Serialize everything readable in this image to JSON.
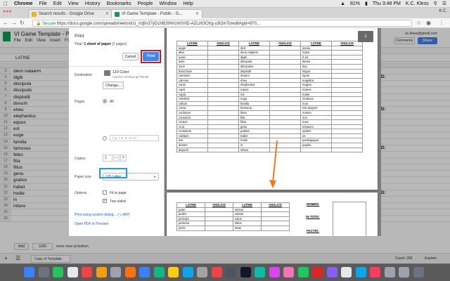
{
  "menubar": {
    "app": "Chrome",
    "items": [
      "File",
      "Edit",
      "View",
      "History",
      "Bookmarks",
      "People",
      "Window",
      "Help"
    ],
    "battery": "81%",
    "clock": "Thu 3:48 PM",
    "user": "K.C. Kless"
  },
  "tabs": [
    {
      "label": "Search results - Google Drive",
      "favicon_color": "#f4b400"
    },
    {
      "label": "VI Game Template - Public - G...",
      "favicon_color": "#0f9d58"
    }
  ],
  "profile_name": "K.C.",
  "omnibox": {
    "secure_label": "Secure",
    "url": "https://docs.google.com/spreadsheets/d/1i_Vq5v37yD1hB2tNVcIn0VtD-AZcz63CKg-u3t2mTo/edit#gid=970..."
  },
  "sheets": {
    "title": "VI Game Template - Pu",
    "menu": [
      "File",
      "Edit",
      "View",
      "Insert",
      "Fo"
    ],
    "user_email": "kc.kless@gmail.com",
    "comments_label": "Comments",
    "share_label": "Share",
    "formula_value": "LATINE",
    "row_numbers": [
      "3",
      "4",
      "5",
      "6",
      "7",
      "8",
      "9",
      "10",
      "11",
      "12",
      "13",
      "14",
      "15",
      "16",
      "17",
      "18",
      "19",
      "20",
      "21",
      "22",
      "23",
      "24",
      "25",
      "26"
    ],
    "col_a": [
      "diem nataiem",
      "digiti",
      "discipula",
      "discipulis",
      "displodit",
      "donum",
      "eheu",
      "elephantus",
      "equus",
      "est",
      "euge",
      "familia",
      "famosus",
      "feles",
      "filia",
      "filius",
      "genu",
      "gratios",
      "habet",
      "hodie",
      "in",
      "infans",
      "",
      ""
    ],
    "right_cells": [
      "",
      "D:",
      "",
      "",
      "",
      "",
      "D:",
      "",
      "",
      "",
      "",
      "",
      "D:",
      "",
      "",
      "",
      "",
      "",
      "",
      "D:",
      "",
      "",
      "",
      ""
    ],
    "bottom_cells": [
      "papilio",
      "sextum"
    ],
    "add_label": "Add",
    "add_count": "1000",
    "add_suffix": "more rows at bottom.",
    "sheet_tab": "Copy of Template",
    "count_label": "Count: 266",
    "explore_label": "Explore"
  },
  "print": {
    "title": "Print",
    "total_prefix": "Total:",
    "total_bold": "1 sheet of paper",
    "total_suffix": "(2 pages)",
    "cancel_label": "Cancel",
    "print_label": "Print",
    "destination_label": "Destination",
    "destination_name": "110 Color",
    "destination_sub": "Generic PostScript Printer",
    "change_label": "Change...",
    "pages_label": "Pages",
    "pages_all": "All",
    "pages_placeholder": "e.g. 1-5, 8, 11-13",
    "copies_label": "Copies",
    "copies_value": "1",
    "paper_label": "Paper size",
    "paper_value": "US Letter",
    "options_label": "Options",
    "fit_label": "Fit to page",
    "twosided_label": "Two-sided",
    "system_dialog_link": "Print using system dialog... (⌥⌘P)",
    "open_pdf_link": "Open PDF in Preview"
  },
  "preview": {
    "page_number": "1",
    "page1_headers": [
      "LATINE",
      "ANGLICE",
      "LATINE",
      "ANGLICE",
      "LATINE",
      "ANGLICE"
    ],
    "page1_col1": [
      "aeger",
      "albe",
      "aurec",
      "aviis",
      "avus",
      "bracchium",
      "caerulee",
      "calceus",
      "canis",
      "capit",
      "caput",
      "celebrat",
      "collum",
      "coma",
      "confusus",
      "consumit",
      "corpus",
      "crus",
      "crustulum",
      "cubitum",
      "dat",
      "dentes",
      "deponit"
    ],
    "page1_col3": [
      "dicit",
      "diem natalem",
      "digiti",
      "discipula",
      "discipulus",
      "displodit",
      "donum",
      "eheu",
      "elephantus",
      "equus",
      "est",
      "euge",
      "familia",
      "famosus",
      "feles",
      "filia",
      "filius",
      "genu",
      "gratias",
      "habet",
      "hodie",
      "in",
      "infans"
    ],
    "page1_col5": [
      "insula",
      "iratus",
      "it ad",
      "laetus",
      "legi",
      "lingua",
      "lupus",
      "magistra",
      "magna",
      "manus",
      "mater",
      "medicus",
      "mus",
      "nisi tangere",
      "nomen",
      "non",
      "nunc",
      "octavum",
      "optime",
      "os",
      "paedagogus",
      "papilio",
      ""
    ],
    "page2_headers": [
      "LATINE",
      "ANGLICE",
      "LATINE",
      "ANGLICE",
      "NOMEN:"
    ],
    "page2_col1": [
      "pater",
      "pedes",
      "pericula",
      "persona",
      "pictis"
    ],
    "page2_col3": [
      "simius",
      "soleas",
      "solus",
      "stilus",
      "stola"
    ],
    "page2_labels": [
      "IN TOTO:",
      "FACTIO:"
    ]
  },
  "annotation": {
    "arrow_color": "#f07820",
    "print_highlight_color": "#d01818",
    "twosided_highlight_color": "#1a9ee0"
  },
  "dock": {
    "icon_colors": [
      "#3b82f6",
      "#6b7280",
      "#22c55e",
      "#e5e7eb",
      "#ef4444",
      "#f59e0b",
      "#9ca3af",
      "#f97316",
      "#3b82f6",
      "#10b981",
      "#facc15",
      "#0ea5e9",
      "#a3a3a3",
      "#ef4444",
      "#4b5563",
      "#111827",
      "#14b8a6",
      "#d946ef",
      "#f472b6",
      "#22c55e",
      "#dc2626",
      "#8b5cf6",
      "#e5e7eb",
      "#0ea5e9",
      "#f43f5e",
      "#9ca3af",
      "#9ca3af",
      "#6b7280"
    ]
  }
}
